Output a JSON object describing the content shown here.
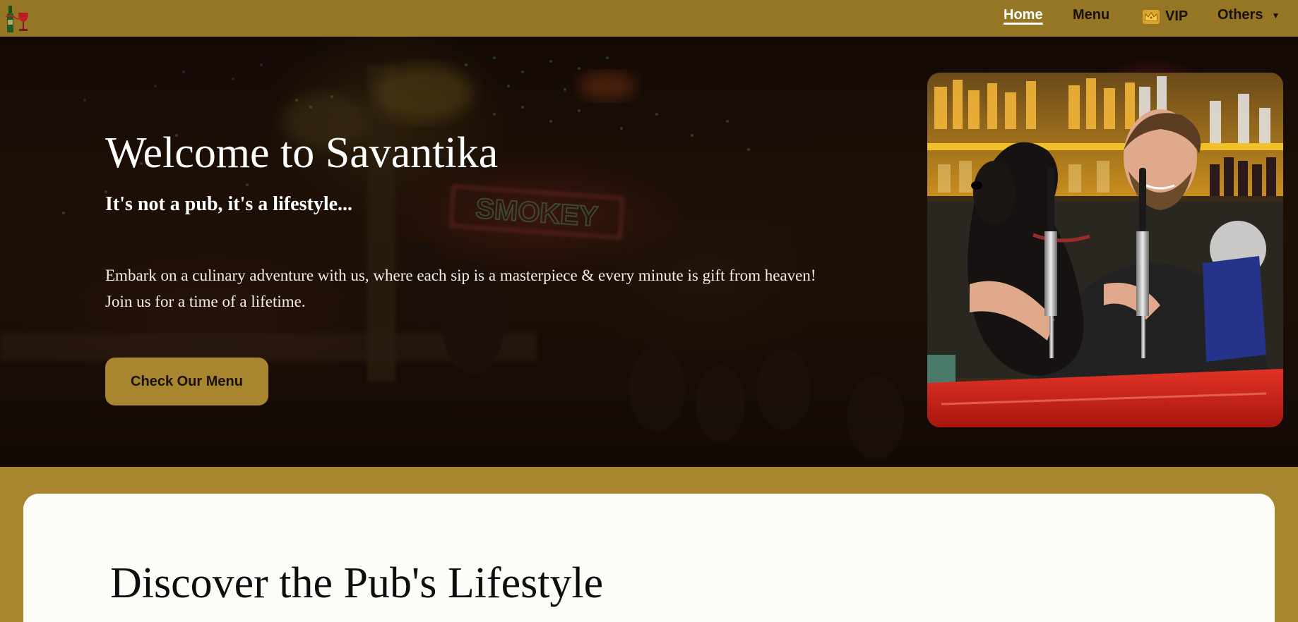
{
  "nav": {
    "logo_icon": "wine-bottle-glass-logo",
    "links": [
      {
        "label": "Home",
        "active": true
      },
      {
        "label": "Menu"
      },
      {
        "label": "VIP",
        "icon": "crown-icon"
      },
      {
        "label": "Others",
        "icon": "chevron-down-icon"
      }
    ]
  },
  "hero": {
    "title": "Welcome to Savantika",
    "subtitle": "It's not a pub, it's a lifestyle...",
    "description": "Embark on a culinary adventure with us, where each sip is a masterpiece & every minute is gift from heaven! Join us for a time of a lifetime.",
    "button_label": "Check Our Menu",
    "neon_sign": "SMOKEY"
  },
  "section": {
    "title": "Discover the Pub's Lifestyle"
  },
  "colors": {
    "navbar": "#957625",
    "accent": "#a8852f",
    "card": "#fdfcf8"
  }
}
